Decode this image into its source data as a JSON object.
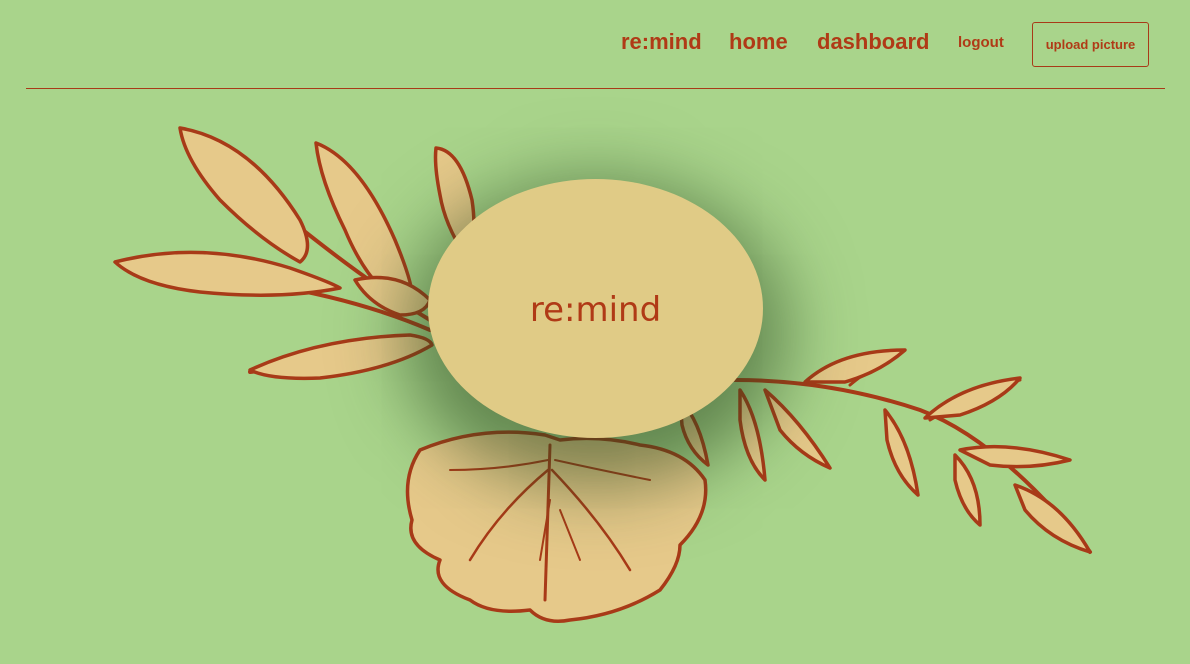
{
  "nav": {
    "brand": "re:mind",
    "home": "home",
    "dashboard": "dashboard",
    "logout": "logout",
    "upload": "upload picture"
  },
  "hero": {
    "logo_text": "re:mind"
  },
  "colors": {
    "background": "#a9d48b",
    "accent": "#b03a16",
    "leaf_fill": "#e6c98a",
    "oval_fill": "#e0cb86"
  },
  "icons": {
    "illustration": "botanical-leaves-illustration"
  }
}
